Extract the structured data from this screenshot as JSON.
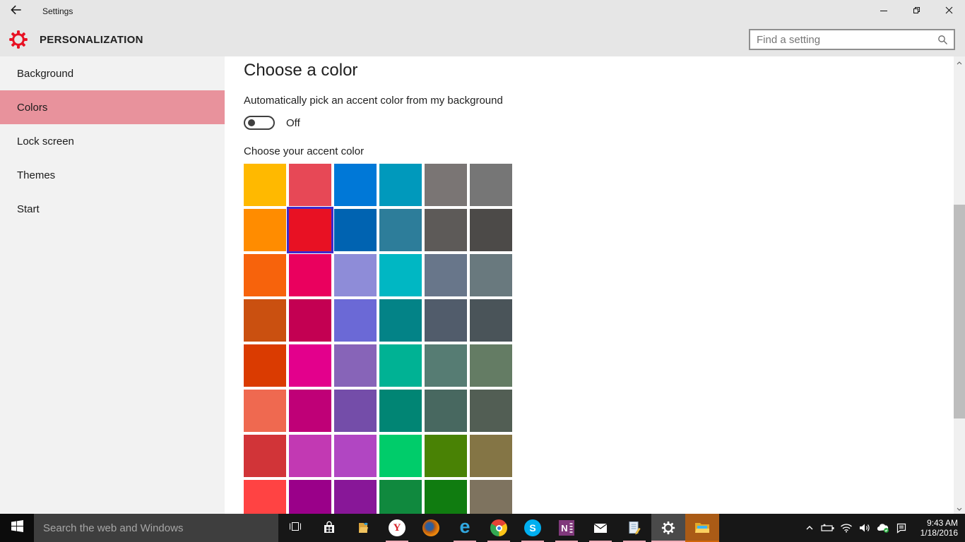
{
  "titlebar": {
    "title": "Settings",
    "back_icon": "back-arrow-icon",
    "minimize_icon": "minimize-icon",
    "restore_icon": "restore-icon",
    "close_icon": "close-icon"
  },
  "header": {
    "page_title": "PERSONALIZATION",
    "gear_icon": "gear-icon",
    "gear_color": "#e81123",
    "search_placeholder": "Find a setting",
    "search_icon": "search-icon"
  },
  "sidebar": {
    "selected_bg": "#e8929c",
    "items": [
      {
        "label": "Background",
        "selected": false
      },
      {
        "label": "Colors",
        "selected": true
      },
      {
        "label": "Lock screen",
        "selected": false
      },
      {
        "label": "Themes",
        "selected": false
      },
      {
        "label": "Start",
        "selected": false
      }
    ]
  },
  "main": {
    "title": "Choose a color",
    "auto_accent_label": "Automatically pick an accent color from my background",
    "toggle_state": "Off",
    "accent_section_label": "Choose your accent color",
    "palette": {
      "columns": 6,
      "selected_index": 7,
      "selected_color": "#E81123",
      "selected_border_color": "#3E28CC",
      "colors": [
        "#FFB900",
        "#E74856",
        "#0078D7",
        "#0099BC",
        "#7A7574",
        "#767676",
        "#FF8C00",
        "#E81123",
        "#0063B1",
        "#2D7D9A",
        "#5D5A58",
        "#4C4A48",
        "#F7630C",
        "#EA005E",
        "#8E8CD8",
        "#00B7C3",
        "#68768A",
        "#69797E",
        "#CA5010",
        "#C30052",
        "#6B69D6",
        "#038387",
        "#515C6B",
        "#4A5459",
        "#DA3B01",
        "#E3008C",
        "#8764B8",
        "#00B294",
        "#567C73",
        "#647C64",
        "#EF6950",
        "#BF0077",
        "#744DA9",
        "#018574",
        "#486860",
        "#525E54",
        "#D13438",
        "#C239B3",
        "#B146C2",
        "#00CC6A",
        "#498205",
        "#847545",
        "#FF4343",
        "#9A0089",
        "#881798",
        "#10893E",
        "#107C10",
        "#7E735F"
      ]
    }
  },
  "scrollbar": {
    "up_icon": "chevron-up-icon",
    "down_icon": "chevron-down-icon"
  },
  "taskbar": {
    "start_icon": "windows-logo-icon",
    "search_placeholder": "Search the web and Windows",
    "task_view_icon": "task-view-icon",
    "underline_color": "#f2aeb9",
    "attention_bg": "#aa5b16",
    "attention_underline": "#d4660a",
    "active_bg": "#4a4a4a",
    "apps": [
      {
        "name": "store",
        "icon": "store-icon",
        "running": false
      },
      {
        "name": "folder-app",
        "icon": "folder-app-icon",
        "running": false
      },
      {
        "name": "yandex",
        "icon": "yandex-icon",
        "running": true
      },
      {
        "name": "firefox",
        "icon": "firefox-icon",
        "running": false
      },
      {
        "name": "edge",
        "icon": "edge-icon",
        "running": true
      },
      {
        "name": "chrome",
        "icon": "chrome-icon",
        "running": true
      },
      {
        "name": "skype",
        "icon": "skype-icon",
        "running": true
      },
      {
        "name": "onenote",
        "icon": "onenote-icon",
        "running": true
      },
      {
        "name": "mail",
        "icon": "mail-icon",
        "running": true
      },
      {
        "name": "notepad",
        "icon": "notepad-icon",
        "running": true
      },
      {
        "name": "settings",
        "icon": "settings-gear-icon",
        "running": true,
        "active": true
      },
      {
        "name": "file-explorer",
        "icon": "file-explorer-icon",
        "running": true,
        "attention": true
      }
    ],
    "tray_icons": [
      "chevron-up-icon",
      "battery-icon",
      "wifi-icon",
      "volume-icon",
      "onedrive-icon",
      "action-center-icon"
    ],
    "clock": {
      "time": "9:43 AM",
      "date": "1/18/2016"
    }
  }
}
